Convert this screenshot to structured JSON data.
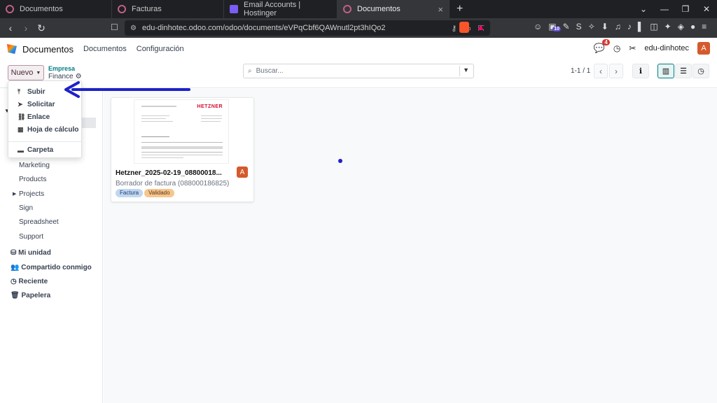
{
  "browser": {
    "tabs": [
      {
        "label": "Documentos",
        "active": false
      },
      {
        "label": "Facturas",
        "active": false
      },
      {
        "label": "Email Accounts | Hostinger",
        "active": false
      },
      {
        "label": "Documentos",
        "active": true
      }
    ],
    "url": "edu-dinhotec.odoo.com/odoo/documents/eVPqCbf6QAWnutl2pt3hIQo2",
    "extension_badge": "10"
  },
  "navbar": {
    "app_name": "Documentos",
    "menus": [
      "Documentos",
      "Configuración"
    ],
    "chat_count": "4",
    "company": "edu-dinhotec",
    "avatar_letter": "A"
  },
  "controls": {
    "new_label": "Nuevo",
    "empresa_label": "Empresa",
    "finance_label": "Finance",
    "search_placeholder": "Buscar...",
    "pager": "1-1 / 1"
  },
  "new_menu": {
    "items": [
      "Subir",
      "Solicitar",
      "Enlace",
      "Hoja de cálculo",
      "Carpeta"
    ]
  },
  "sidebar": {
    "folders": [
      "Marketing",
      "Products",
      "Projects",
      "Sign",
      "Spreadsheet",
      "Support"
    ],
    "sections": [
      "Mi unidad",
      "Compartido conmigo",
      "Reciente",
      "Papelera"
    ]
  },
  "document": {
    "title": "Hetzner_2025-02-19_08800018...",
    "subtitle": "Borrador de factura (088000186825)",
    "tags": [
      "Factura",
      "Validado"
    ],
    "avatar_letter": "A",
    "thumb_brand": "HETZNER"
  },
  "colors": {
    "accent": "#017e84",
    "primary": "#714b67",
    "annotation_arrow": "#1d22c8"
  }
}
